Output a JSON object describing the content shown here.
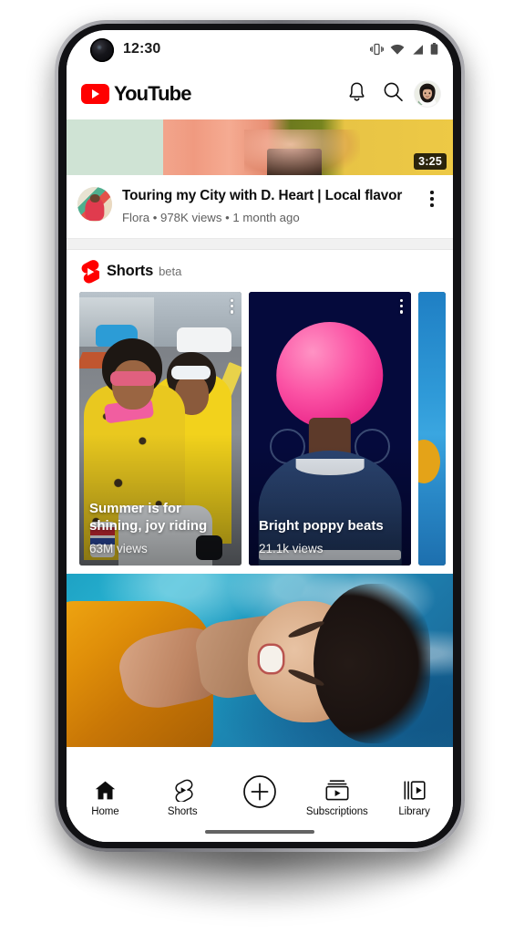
{
  "status_bar": {
    "time": "12:30",
    "icons": [
      "vibrate-icon",
      "wifi-icon",
      "cellular-signal-icon",
      "battery-icon"
    ]
  },
  "header": {
    "logo_text": "YouTube",
    "logo_color": "#FF0000",
    "notifications_label": "Notifications",
    "search_label": "Search",
    "account_label": "Account"
  },
  "feed": {
    "video": {
      "duration": "3:25",
      "title": "Touring my City with D. Heart  | Local flavor",
      "channel": "Flora",
      "views": "978K views",
      "published": "1 month ago",
      "meta_line": "Flora  •  978K views • 1 month ago",
      "menu_label": "More actions"
    },
    "shorts": {
      "title": "Shorts",
      "badge": "beta",
      "accent_color": "#FF0000",
      "cards": [
        {
          "title": "Summer is for shining, joy riding",
          "views": "63M views",
          "menu_label": "More actions"
        },
        {
          "title": "Bright poppy beats",
          "views": "21.1k views",
          "menu_label": "More actions"
        },
        {
          "title": "",
          "views": "",
          "menu_label": ""
        }
      ]
    }
  },
  "bottom_nav": {
    "items": [
      {
        "label": "Home",
        "icon": "home-icon",
        "active": true
      },
      {
        "label": "Shorts",
        "icon": "shorts-icon",
        "active": false
      },
      {
        "label": "Create",
        "icon": "plus-circle-icon",
        "active": false
      },
      {
        "label": "Subscriptions",
        "icon": "subscriptions-icon",
        "active": false
      },
      {
        "label": "Library",
        "icon": "library-icon",
        "active": false
      }
    ]
  }
}
